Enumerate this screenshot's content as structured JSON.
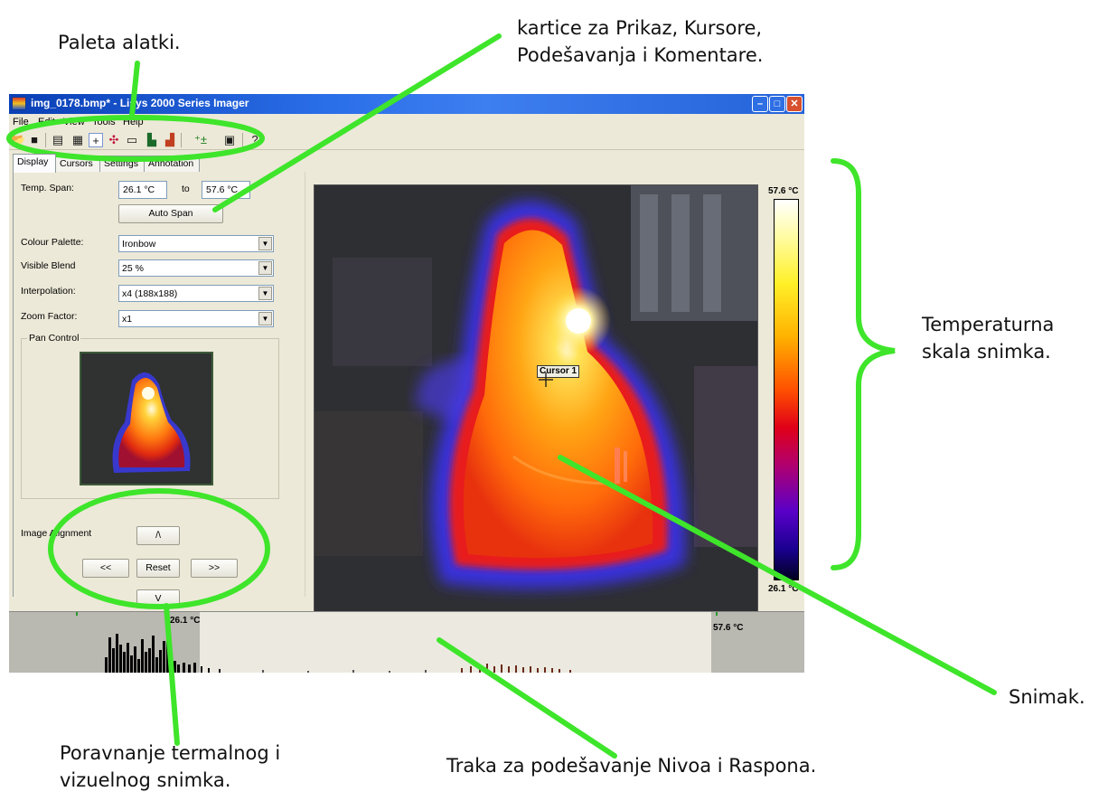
{
  "annotations": {
    "toolbar_palette": "Paleta alatki.",
    "tabs_line1": "kartice za Prikaz, Kursore,",
    "tabs_line2": "Podešavanja i Komentare.",
    "scale_line1": "Temperaturna",
    "scale_line2": "skala snimka.",
    "image": "Snimak.",
    "alignment_line1": "Poravnanje termalnog i",
    "alignment_line2": "vizuelnog snimka.",
    "level_span": "Traka za podešavanje Nivoa i Raspona."
  },
  "colors": {
    "callout_green": "#3ee52a",
    "titlebar_blue": "#1c5ad6",
    "window_face": "#ece9d8"
  },
  "window": {
    "title": "img_0178.bmp* - Lisys 2000 Series Imager",
    "menu": [
      "File",
      "Edit",
      "View",
      "Tools",
      "Help"
    ],
    "toolbar_icons": [
      "open-icon",
      "save-icon",
      "properties-icon",
      "export-icon",
      "crosshair-icon",
      "move-cursor-icon",
      "rectangle-icon",
      "histogram-icon",
      "histogram-color-icon",
      "add-cursor-icon",
      "info-icon",
      "help-icon"
    ]
  },
  "tabs": [
    "Display",
    "Cursors",
    "Settings",
    "Annotation"
  ],
  "display": {
    "temp_span_label": "Temp. Span:",
    "temp_min": "26.1 °C",
    "to_label": "to",
    "temp_max": "57.6 °C",
    "auto_span": "Auto Span",
    "palette_label": "Colour Palette:",
    "palette_value": "Ironbow",
    "blend_label": "Visible Blend",
    "blend_value": "25 %",
    "interp_label": "Interpolation:",
    "interp_value": "x4 (188x188)",
    "zoom_label": "Zoom Factor:",
    "zoom_value": "x1",
    "pan_label": "Pan Control",
    "align_label": "Image Alignment",
    "up": "/\\",
    "left": "<<",
    "reset": "Reset",
    "right": ">>",
    "down": "V"
  },
  "image": {
    "cursor_label": "Cursor 1"
  },
  "scale": {
    "max": "57.6 °C",
    "min": "26.1 °C"
  },
  "histogram": {
    "low": "26.1 °C",
    "high": "57.6 °C"
  }
}
